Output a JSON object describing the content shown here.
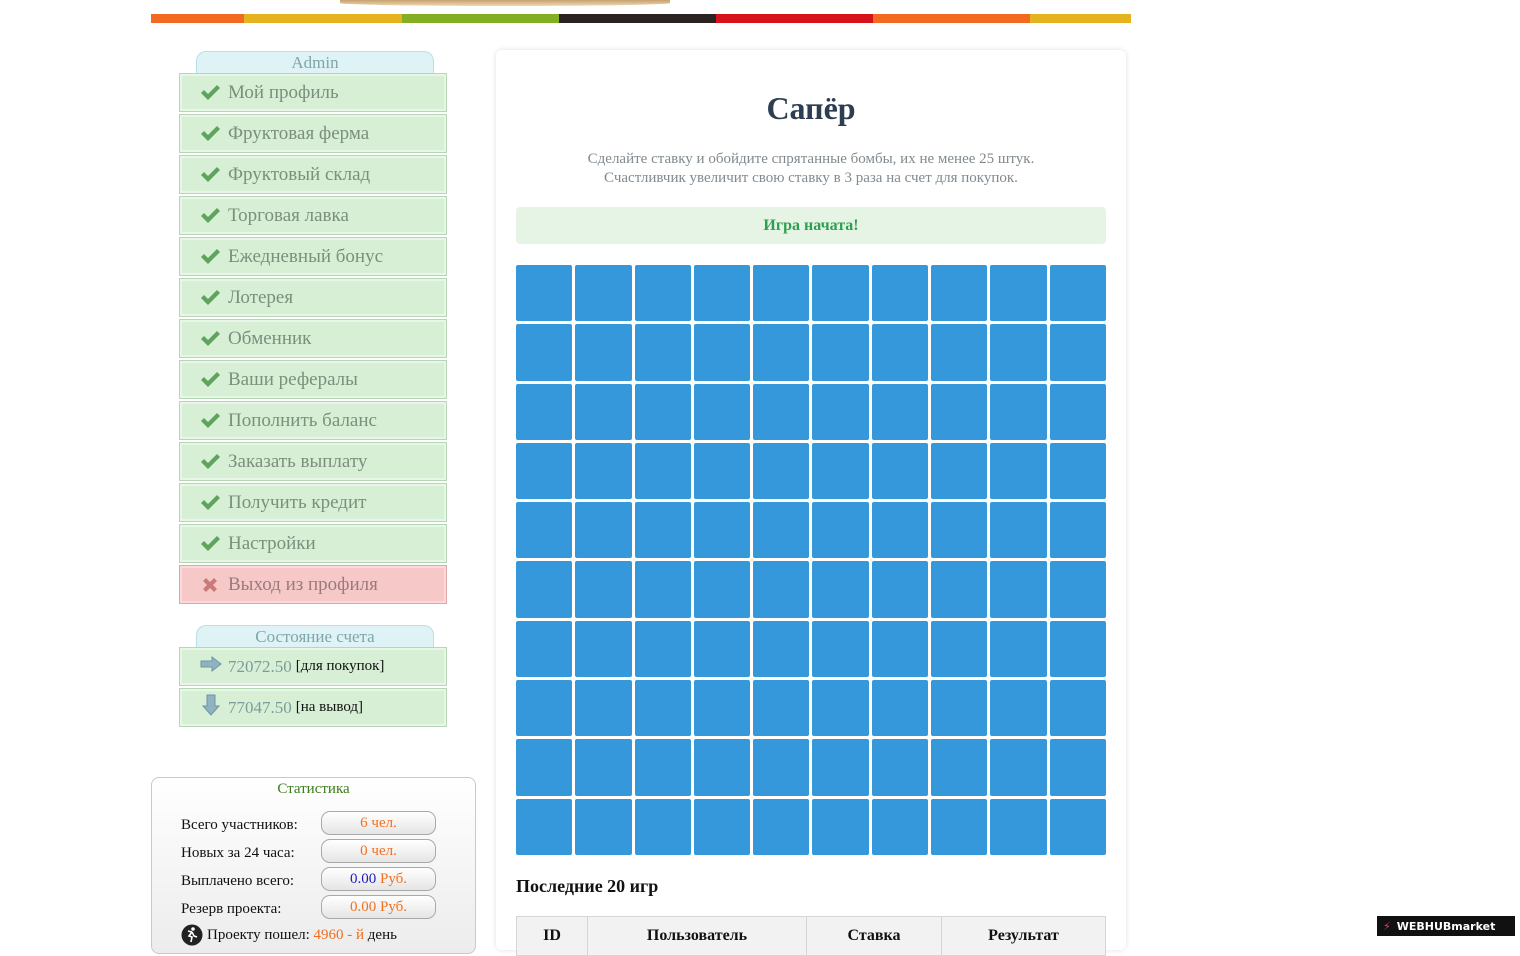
{
  "colors": {
    "strip": [
      "#f26a21",
      "#e4b31f",
      "#84ae24",
      "#2b2222",
      "#d6121a",
      "#f26a21",
      "#e4b31f"
    ],
    "cell": "#3498db",
    "status_green": "#2f9e4f",
    "menu_bg": "#d6efd5",
    "logout_bg": "#f6c8c8"
  },
  "sidebar": {
    "user_tab": "Admin",
    "menu": [
      {
        "label": "Мой профиль",
        "icon": "check-icon"
      },
      {
        "label": "Фруктовая ферма",
        "icon": "check-icon"
      },
      {
        "label": "Фруктовый склад",
        "icon": "check-icon"
      },
      {
        "label": "Торговая лавка",
        "icon": "check-icon"
      },
      {
        "label": "Ежедневный бонус",
        "icon": "check-icon"
      },
      {
        "label": "Лотерея",
        "icon": "check-icon"
      },
      {
        "label": "Обменник",
        "icon": "check-icon"
      },
      {
        "label": "Ваши рефералы",
        "icon": "check-icon"
      },
      {
        "label": "Пополнить баланс",
        "icon": "check-icon"
      },
      {
        "label": "Заказать выплату",
        "icon": "check-icon"
      },
      {
        "label": "Получить кредит",
        "icon": "check-icon"
      },
      {
        "label": "Настройки",
        "icon": "check-icon"
      },
      {
        "label": "Выход из профиля",
        "icon": "close-icon"
      }
    ],
    "account_tab": "Состояние счета",
    "account": {
      "buy_amount": "72072.50",
      "buy_label": "[для покупок]",
      "withdraw_amount": "77047.50",
      "withdraw_label": "[на вывод]"
    }
  },
  "stats": {
    "title": "Статистика",
    "total_label": "Всего участников:",
    "total_value": "6 чел.",
    "new_label": "Новых за 24 часа:",
    "new_value": "0 чел.",
    "paid_label": "Выплачено всего:",
    "paid_value": "0.00",
    "paid_unit": "Руб.",
    "reserve_label": "Резерв проекта:",
    "reserve_value": "0.00 Руб.",
    "days_label": "Проекту пошел:",
    "days_value": "4960 - й",
    "days_unit": "день"
  },
  "game": {
    "title": "Сапёр",
    "desc_line1": "Сделайте ставку и обойдите спрятанные бомбы, их не менее 25 штук.",
    "desc_line2": "Счастливчик увеличит свою ставку в 3 раза на счет для покупок.",
    "status": "Игра начата!",
    "grid_rows": 10,
    "grid_cols": 10,
    "last_games_title": "Последние 20 игр",
    "table_headers": [
      "ID",
      "Пользователь",
      "Ставка",
      "Результат"
    ]
  },
  "badge": "WEBHUBmarket"
}
